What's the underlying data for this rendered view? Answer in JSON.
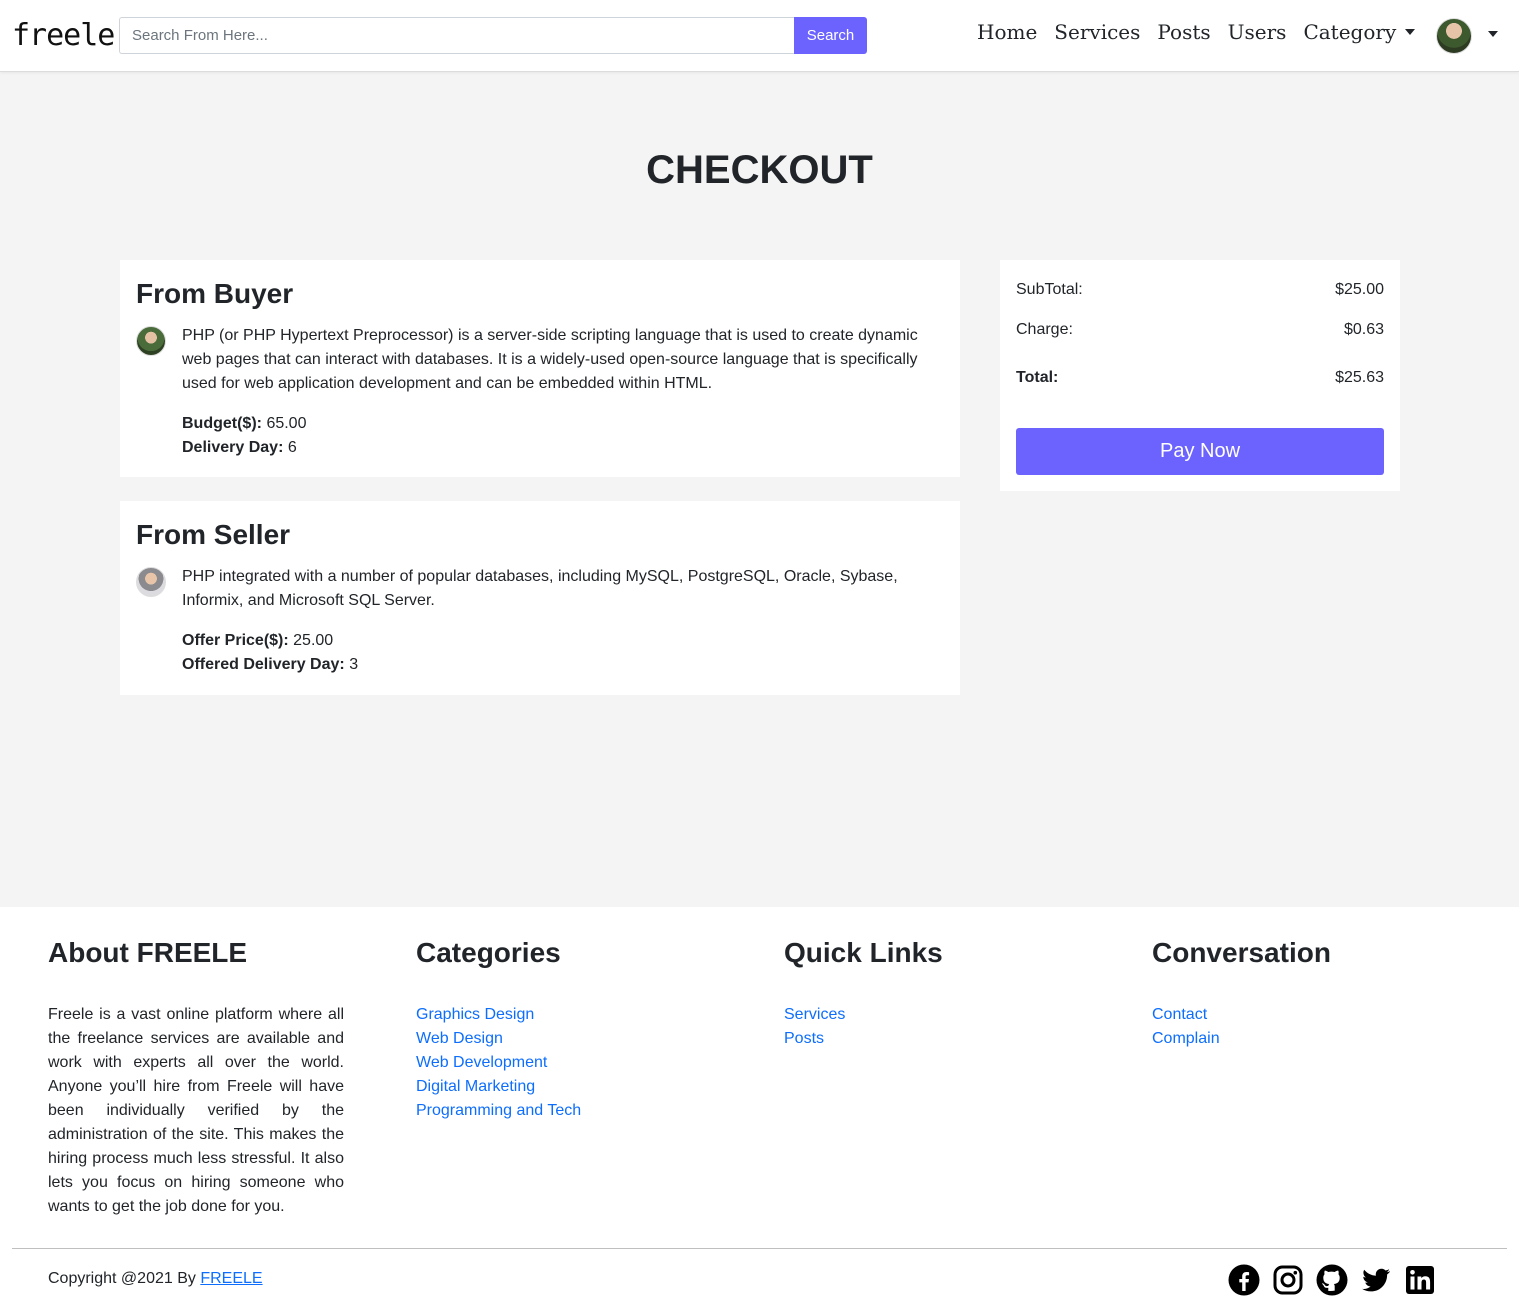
{
  "header": {
    "brand": "freele",
    "search": {
      "placeholder": "Search From Here...",
      "value": "",
      "button_label": "Search"
    },
    "nav": [
      "Home",
      "Services",
      "Posts",
      "Users",
      "Category"
    ]
  },
  "page": {
    "title": "CHECKOUT"
  },
  "buyer": {
    "heading": "From Buyer",
    "message": "PHP (or PHP Hypertext Preprocessor) is a server-side scripting language that is used to create dynamic web pages that can interact with databases. It is a widely-used open-source language that is specifically used for web application development and can be embedded within HTML.",
    "budget_label": "Budget($):",
    "budget_value": "65.00",
    "delivery_label": "Delivery Day:",
    "delivery_value": "6"
  },
  "seller": {
    "heading": "From Seller",
    "message": "PHP integrated with a number of popular databases, including MySQL, PostgreSQL, Oracle, Sybase, Informix, and Microsoft SQL Server.",
    "offer_label": "Offer Price($):",
    "offer_value": "25.00",
    "delivery_label": "Offered Delivery Day:",
    "delivery_value": "3"
  },
  "summary": {
    "subtotal_label": "SubTotal:",
    "subtotal_value": "$25.00",
    "charge_label": "Charge:",
    "charge_value": "$0.63",
    "total_label": "Total:",
    "total_value": "$25.63",
    "pay_label": "Pay Now"
  },
  "footer": {
    "about_heading": "About FREELE",
    "about_text": "Freele is a vast online platform where all the freelance services are available and work with experts all over the world. Anyone you’ll hire from Freele will have been individually verified by the administration of the site. This makes the hiring process much less stressful. It also lets you focus on hiring someone who wants to get the job done for you.",
    "categories_heading": "Categories",
    "categories": [
      "Graphics Design",
      "Web Design",
      "Web Development",
      "Digital Marketing",
      "Programming and Tech"
    ],
    "quick_heading": "Quick Links",
    "quick_links": [
      "Services",
      "Posts"
    ],
    "conv_heading": "Conversation",
    "conv_links": [
      "Contact",
      "Complain"
    ],
    "copyright_prefix": "Copyright @2021 By ",
    "copyright_link": "FREELE",
    "socials": [
      "facebook-icon",
      "instagram-icon",
      "github-icon",
      "twitter-icon",
      "linkedin-icon"
    ]
  },
  "colors": {
    "accent": "#6c63ff",
    "link": "#0d6efd",
    "page_bg": "#f4f4f4"
  }
}
